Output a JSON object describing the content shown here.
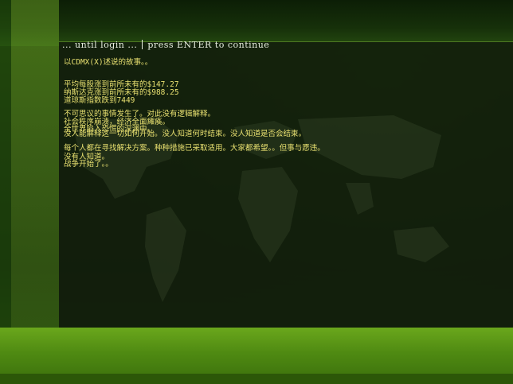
{
  "prompt": {
    "wait_text": "... until login ...",
    "continue_text": "press ENTER to continue"
  },
  "terminal": {
    "intro": "以CDMX(X)述说的故事。。",
    "stats": [
      "平均每股涨到前所未有的$147.27",
      "纳斯达克涨到前所未有的$988.25",
      "道琼斯指数跌到7449"
    ],
    "paragraph1": [
      "不可思议的事情发生了。对此没有逻辑解释。",
      "社会秩序崩溃，经济全面瘫痪。",
      "全世界陷入恐慌的深渊中。",
      "没人能解释这一切如何开始。没人知道何时结束。没人知道是否会结束。"
    ],
    "paragraph2": [
      "每个人都在寻找解决方案。种种措施已采取适用。大家都希望。。但事与愿违。",
      "没有人知道。",
      "战争开始了。。"
    ]
  },
  "colors": {
    "terminal_text": "#e8e070",
    "prompt_text": "#e8efe0",
    "accent_green": "#6aa71c"
  }
}
